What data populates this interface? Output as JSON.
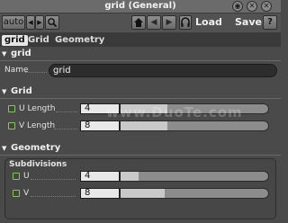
{
  "window": {
    "title": "grid (General)",
    "buttons": [
      "◉",
      "✕",
      "✕"
    ]
  },
  "toolbar": {
    "preset_label": "auto",
    "load_label": "Load",
    "save_label": "Save",
    "help_label": "?"
  },
  "tabs": [
    "grid",
    "Grid",
    "Geometry"
  ],
  "sections": {
    "node": {
      "header": "grid",
      "name_label": "Name",
      "name_value": "grid"
    },
    "grid": {
      "header": "Grid",
      "u_label": "U Length",
      "u_value": "4",
      "u_fill": 0.32,
      "v_label": "V Length",
      "v_value": "8",
      "v_fill": 0.32
    },
    "geometry": {
      "header": "Geometry",
      "subgroup_label": "Subdivisions",
      "u_label": "U",
      "u_value": "4",
      "u_fill": 0.12,
      "v_label": "V",
      "v_value": "8",
      "v_fill": 0.3
    }
  },
  "watermark": "www.DuoTe.com",
  "colors": {
    "accent_check": "#8fbf6a",
    "panel_bg": "#4a4a4a"
  }
}
